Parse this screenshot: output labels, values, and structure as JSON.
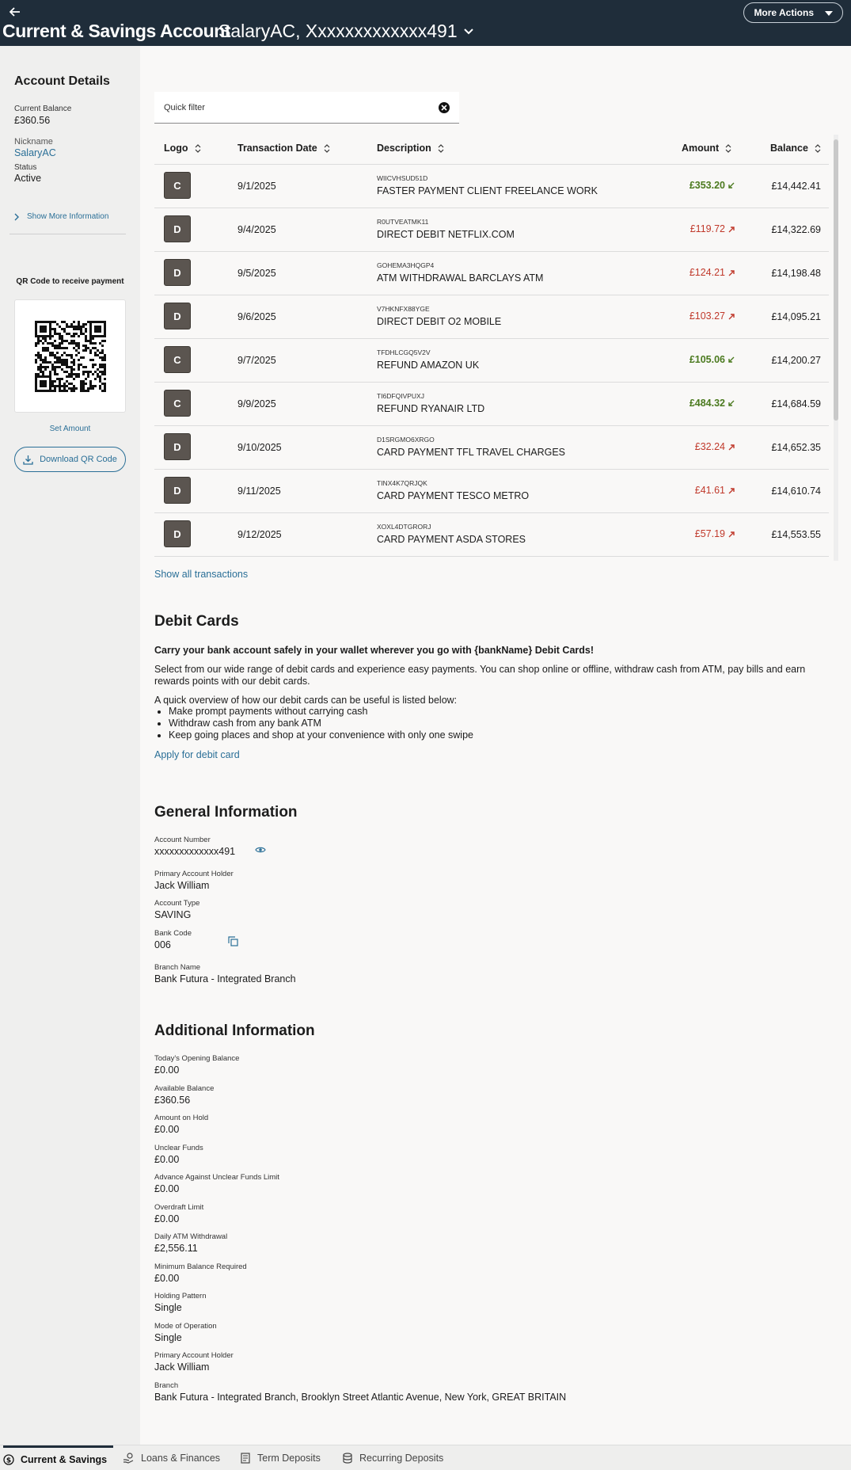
{
  "header": {
    "title": "Current & Savings Account",
    "account_selector": "SalaryAC, Xxxxxxxxxxxxx491",
    "more_actions": "More Actions"
  },
  "sidebar": {
    "title": "Account Details",
    "current_balance_label": "Current Balance",
    "current_balance": "£360.56",
    "nickname_label": "Nickname",
    "nickname": "SalaryAC",
    "status_label": "Status",
    "status": "Active",
    "show_more": "Show More Information",
    "qr_title": "QR Code to receive payment",
    "set_amount": "Set Amount",
    "download_qr": "Download QR Code"
  },
  "filter": {
    "placeholder": "Quick filter"
  },
  "table": {
    "headers": {
      "logo": "Logo",
      "date": "Transaction Date",
      "description": "Description",
      "amount": "Amount",
      "balance": "Balance"
    },
    "rows": [
      {
        "logo": "C",
        "date": "9/1/2025",
        "ref": "WIICVHSUD51D",
        "desc": "FASTER PAYMENT CLIENT FREELANCE WORK",
        "amount": "£353.20",
        "type": "credit",
        "balance": "£14,442.41"
      },
      {
        "logo": "D",
        "date": "9/4/2025",
        "ref": "R0UTVEATMK11",
        "desc": "DIRECT DEBIT NETFLIX.COM",
        "amount": "£119.72",
        "type": "debit",
        "balance": "£14,322.69"
      },
      {
        "logo": "D",
        "date": "9/5/2025",
        "ref": "GOHEMA3HQGP4",
        "desc": "ATM WITHDRAWAL BARCLAYS ATM",
        "amount": "£124.21",
        "type": "debit",
        "balance": "£14,198.48"
      },
      {
        "logo": "D",
        "date": "9/6/2025",
        "ref": "V7HKNFX88YGE",
        "desc": "DIRECT DEBIT O2 MOBILE",
        "amount": "£103.27",
        "type": "debit",
        "balance": "£14,095.21"
      },
      {
        "logo": "C",
        "date": "9/7/2025",
        "ref": "TFDHLCGQ5V2V",
        "desc": "REFUND AMAZON UK",
        "amount": "£105.06",
        "type": "credit",
        "balance": "£14,200.27"
      },
      {
        "logo": "C",
        "date": "9/9/2025",
        "ref": "TI6DFQIVPUXJ",
        "desc": "REFUND RYANAIR LTD",
        "amount": "£484.32",
        "type": "credit",
        "balance": "£14,684.59"
      },
      {
        "logo": "D",
        "date": "9/10/2025",
        "ref": "D1SRGMO6XRGO",
        "desc": "CARD PAYMENT TFL TRAVEL CHARGES",
        "amount": "£32.24",
        "type": "debit",
        "balance": "£14,652.35"
      },
      {
        "logo": "D",
        "date": "9/11/2025",
        "ref": "TINX4K7QRJQK",
        "desc": "CARD PAYMENT TESCO METRO",
        "amount": "£41.61",
        "type": "debit",
        "balance": "£14,610.74"
      },
      {
        "logo": "D",
        "date": "9/12/2025",
        "ref": "XOXL4DTGRORJ",
        "desc": "CARD PAYMENT ASDA STORES",
        "amount": "£57.19",
        "type": "debit",
        "balance": "£14,553.55"
      }
    ],
    "show_all": "Show all transactions"
  },
  "debit_cards": {
    "title": "Debit Cards",
    "tagline": "Carry your bank account safely in your wallet wherever you go with {bankName} Debit Cards!",
    "intro": "Select from our wide range of debit cards and experience easy payments. You can shop online or offline, withdraw cash from ATM, pay bills and earn rewards points with our debit cards.",
    "overview": "A quick overview of how our debit cards can be useful is listed below:",
    "bullets": [
      "Make prompt payments without carrying cash",
      "Withdraw cash from any bank ATM",
      "Keep going places and shop at your convenience with only one swipe"
    ],
    "apply": "Apply for debit card"
  },
  "general": {
    "title": "General Information",
    "fields": [
      {
        "label": "Account Number",
        "value": "xxxxxxxxxxxxx491"
      },
      {
        "label": "Primary Account Holder",
        "value": "Jack William"
      },
      {
        "label": "Account Type",
        "value": "SAVING"
      },
      {
        "label": "Bank Code",
        "value": "006"
      },
      {
        "label": "Branch Name",
        "value": "Bank Futura - Integrated Branch"
      }
    ]
  },
  "additional": {
    "title": "Additional Information",
    "fields": [
      {
        "label": "Today's Opening Balance",
        "value": "£0.00"
      },
      {
        "label": "Available Balance",
        "value": "£360.56"
      },
      {
        "label": "Amount on Hold",
        "value": "£0.00"
      },
      {
        "label": "Unclear Funds",
        "value": "£0.00"
      },
      {
        "label": "Advance Against Unclear Funds Limit",
        "value": "£0.00"
      },
      {
        "label": "Overdraft Limit",
        "value": "£0.00"
      },
      {
        "label": "Daily ATM Withdrawal",
        "value": "£2,556.11"
      },
      {
        "label": "Minimum Balance Required",
        "value": "£0.00"
      },
      {
        "label": "Holding Pattern",
        "value": "Single"
      },
      {
        "label": "Mode of Operation",
        "value": "Single"
      },
      {
        "label": "Primary Account Holder",
        "value": "Jack William"
      },
      {
        "label": "Branch",
        "value": "Bank Futura - Integrated Branch, Brooklyn Street Atlantic Avenue, New York, GREAT BRITAIN"
      }
    ]
  },
  "bottom_tabs": [
    {
      "label": "Current & Savings",
      "icon": "dollar-circle-icon",
      "active": true
    },
    {
      "label": "Loans & Finances",
      "icon": "hand-coin-icon",
      "active": false
    },
    {
      "label": "Term Deposits",
      "icon": "receipt-icon",
      "active": false
    },
    {
      "label": "Recurring Deposits",
      "icon": "coin-stack-icon",
      "active": false
    }
  ],
  "colors": {
    "header": "#1f2d3a",
    "link": "#2a6f97",
    "credit": "#4b7a1f",
    "debit": "#c0392b"
  }
}
